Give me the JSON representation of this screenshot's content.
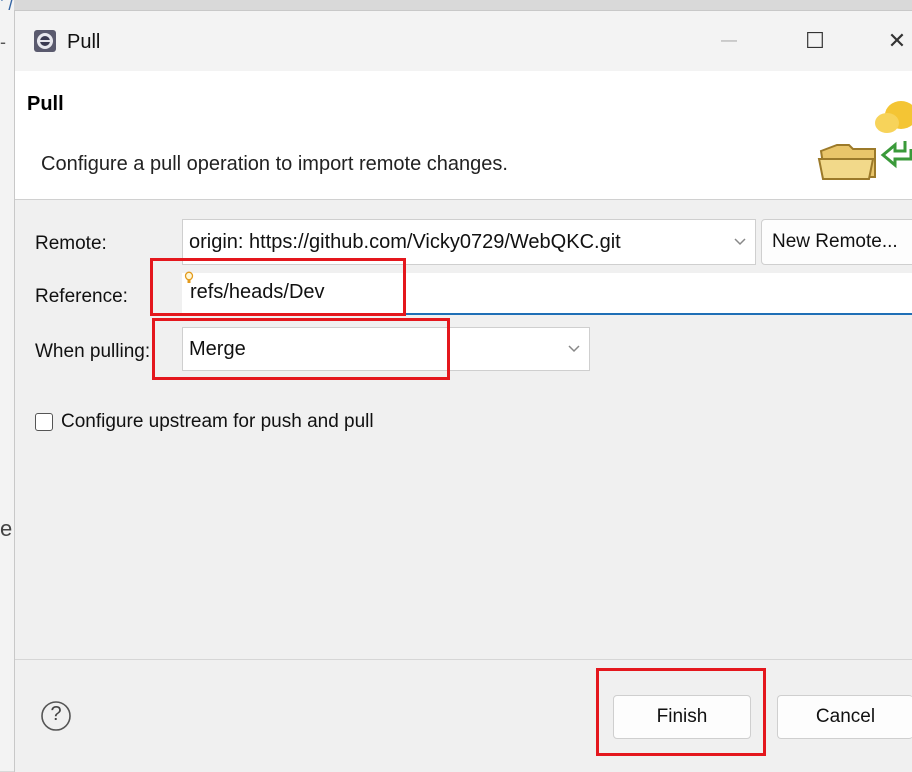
{
  "background": {
    "fragments": [
      "’ /",
      "-",
      "e"
    ]
  },
  "window": {
    "title": "Pull",
    "minimize_glyph": "—",
    "maximize_glyph": "☐",
    "close_glyph": "✕"
  },
  "header": {
    "title": "Pull",
    "description": "Configure a pull operation to import remote changes."
  },
  "form": {
    "remote_label": "Remote:",
    "remote_value": "origin: https://github.com/Vicky0729/WebQKC.git",
    "new_remote_label": "New Remote...",
    "reference_label": "Reference:",
    "reference_value": "refs/heads/Dev",
    "when_pulling_label": "When pulling:",
    "when_pulling_value": "Merge",
    "upstream_checkbox_label": "Configure upstream for push and pull",
    "upstream_checked": false
  },
  "footer": {
    "help_glyph": "?",
    "finish_label": "Finish",
    "cancel_label": "Cancel"
  },
  "colors": {
    "highlight": "#e4171d",
    "focus_underline": "#1f6fb6"
  },
  "icons": {
    "chevron": "chevron-down-icon",
    "help": "help-icon",
    "content_assist": "lightbulb-icon"
  }
}
